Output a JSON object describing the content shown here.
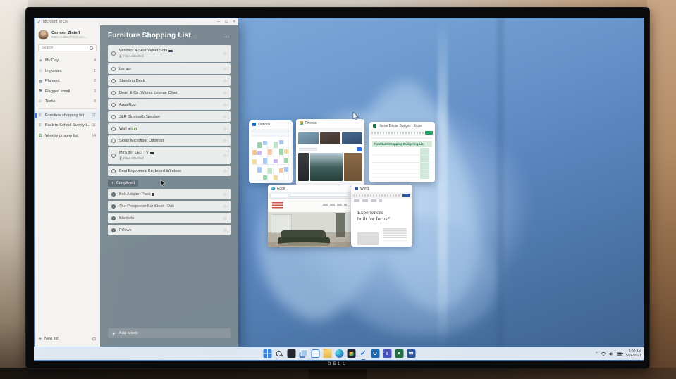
{
  "monitor": {
    "brand": "DELL"
  },
  "todo": {
    "title_bar": {
      "logo_glyph": "✓",
      "app_title": "Microsoft To Do",
      "minimize": "–",
      "maximize": "□",
      "close": "×"
    },
    "user": {
      "name": "Carmen Zlateff",
      "email": "Carmen.Zlateff00@outlo..."
    },
    "search": {
      "placeholder": "Search"
    },
    "sidebar_items": [
      {
        "icon": "sun-icon",
        "glyph": "☀",
        "label": "My Day",
        "count": "4"
      },
      {
        "icon": "star-icon",
        "glyph": "☆",
        "label": "Important",
        "count": "1"
      },
      {
        "icon": "calendar-icon",
        "glyph": "▦",
        "label": "Planned",
        "count": "2"
      },
      {
        "icon": "flag-icon",
        "glyph": "⚑",
        "label": "Flagged email",
        "count": "3"
      },
      {
        "icon": "home-icon",
        "glyph": "⌂",
        "label": "Tasks",
        "count": "9"
      },
      {
        "icon": "list-icon",
        "glyph": "≡",
        "label": "Furniture shopping list",
        "count": "11",
        "selected": true
      },
      {
        "icon": "list-icon",
        "glyph": "≡",
        "label": "Back to School Supply L...",
        "count": "11"
      },
      {
        "icon": "grocery-icon",
        "glyph": "✿",
        "icon_color": "#5a9e4a",
        "label": "Weekly grocery list",
        "count": "14"
      }
    ],
    "new_list_plus": "+",
    "new_list_label": "New list",
    "group_glyph": "⊞",
    "list": {
      "title": "Furniture Shopping List",
      "title_emoji": "⌂",
      "more_label": "...",
      "star_glyph": "☆",
      "done_glyph": "✓",
      "completed_chevron": "∨",
      "completed_header": "Completed",
      "add_plus": "+",
      "add_task_label": "Add a task",
      "tasks": [
        {
          "label": "Windsor 4-Seat Velvet Sofa",
          "icon": "sofa-icon",
          "note": "Files attached"
        },
        {
          "label": "Lamps"
        },
        {
          "label": "Standing Desk"
        },
        {
          "label": "Dean & Co. Walnut Lounge Chair"
        },
        {
          "label": "Area Rug"
        },
        {
          "label": "J&R Bluetooth Speaker"
        },
        {
          "label": "Wall art",
          "icon": "frame-icon"
        },
        {
          "label": "Sloan Microfiber Ottoman"
        },
        {
          "label": "Mira 80\" LED TV",
          "icon": "tv-icon",
          "note": "Files attached"
        },
        {
          "label": "Beni Ergonomic Keyboard Wireless"
        }
      ],
      "completed": [
        {
          "label": "Bolt Adapter Pack",
          "icon": "plug-icon"
        },
        {
          "label": "The Prospector Bar Stool - Oak"
        },
        {
          "label": "Blankets"
        },
        {
          "label": "Pillows"
        }
      ]
    }
  },
  "thumbnails": {
    "outlook": {
      "title": "Outlook",
      "accent": "#1c6ab2",
      "events": [
        {
          "c": 1,
          "t": 3,
          "h": 8,
          "color": "#9cd3ab"
        },
        {
          "c": 2,
          "t": 1,
          "h": 6,
          "color": "#aac9f1"
        },
        {
          "c": 4,
          "t": 2,
          "h": 9,
          "color": "#bfe3c8"
        },
        {
          "c": 5,
          "t": 0,
          "h": 6,
          "color": "#aac9f1"
        },
        {
          "c": 0,
          "t": 14,
          "h": 7,
          "color": "#f5c59b"
        },
        {
          "c": 1,
          "t": 15,
          "h": 6,
          "color": "#cdb7ee"
        },
        {
          "c": 3,
          "t": 13,
          "h": 8,
          "color": "#f5c59b"
        },
        {
          "c": 5,
          "t": 12,
          "h": 9,
          "color": "#9cd3ab"
        },
        {
          "c": 6,
          "t": 13,
          "h": 6,
          "color": "#f1de9b"
        },
        {
          "c": 0,
          "t": 27,
          "h": 7,
          "color": "#f1de9b"
        },
        {
          "c": 2,
          "t": 25,
          "h": 9,
          "color": "#aac9f1"
        },
        {
          "c": 4,
          "t": 27,
          "h": 6,
          "color": "#cdb7ee"
        },
        {
          "c": 6,
          "t": 25,
          "h": 8,
          "color": "#9cd3ab"
        },
        {
          "c": 1,
          "t": 38,
          "h": 8,
          "color": "#aac9f1"
        },
        {
          "c": 3,
          "t": 39,
          "h": 9,
          "color": "#bfe3c8"
        },
        {
          "c": 5,
          "t": 40,
          "h": 6,
          "color": "#f5c59b"
        },
        {
          "c": 6,
          "t": 38,
          "h": 7,
          "color": "#aac9f1"
        },
        {
          "c": 2,
          "t": 50,
          "h": 6,
          "color": "#9cd3ab"
        },
        {
          "c": 4,
          "t": 50,
          "h": 7,
          "color": "#f1de9b"
        }
      ]
    },
    "photos": {
      "title": "Photos",
      "accent": "#3b82d8",
      "tiles_top": [
        "#7fa3b8",
        "#564741",
        "#46688f"
      ],
      "tiles_bottom": [
        {
          "w": 16,
          "colors": [
            "#3a3d42",
            "#23262b"
          ]
        },
        {
          "w": 48,
          "colors": [
            "#b9cdd8",
            "#41605c",
            "#27403c"
          ]
        },
        {
          "w": 27,
          "colors": [
            "#8a6a48",
            "#6e5336"
          ]
        }
      ]
    },
    "excel": {
      "title": "Home Décor Budget - Excel",
      "accent": "#1e7145",
      "sheet_banner": "Furniture Shopping Budgeting List"
    },
    "edge": {
      "title": "Edge",
      "accent": "#2f86c9"
    },
    "word": {
      "title": "Word",
      "accent": "#2b579a",
      "doc_heading_line1": "Experiences",
      "doc_heading_line2": "built for focus*"
    }
  },
  "taskbar": {
    "icons": [
      {
        "name": "start-button",
        "type": "windows"
      },
      {
        "name": "search-button",
        "type": "search"
      },
      {
        "name": "widgets-button",
        "type": "dark"
      },
      {
        "name": "task-view-button",
        "type": "taskview"
      },
      {
        "name": "chat-button",
        "type": "chat"
      },
      {
        "name": "file-explorer-button",
        "type": "folder"
      },
      {
        "name": "edge-button",
        "type": "edge"
      },
      {
        "name": "photos-button",
        "type": "photos"
      },
      {
        "name": "todo-button",
        "type": "check",
        "active": true
      },
      {
        "name": "outlook-button",
        "type": "tile",
        "letter": "O",
        "color": "#1c6ab2"
      },
      {
        "name": "teams-button",
        "type": "tile",
        "letter": "T",
        "color": "#4b53bc"
      },
      {
        "name": "excel-button",
        "type": "tile",
        "letter": "X",
        "color": "#1e7145"
      },
      {
        "name": "word-button",
        "type": "tile",
        "letter": "W",
        "color": "#2b579a"
      }
    ],
    "tray": {
      "chevron": "^",
      "time": "9:00 AM",
      "date": "5/24/2021"
    }
  }
}
